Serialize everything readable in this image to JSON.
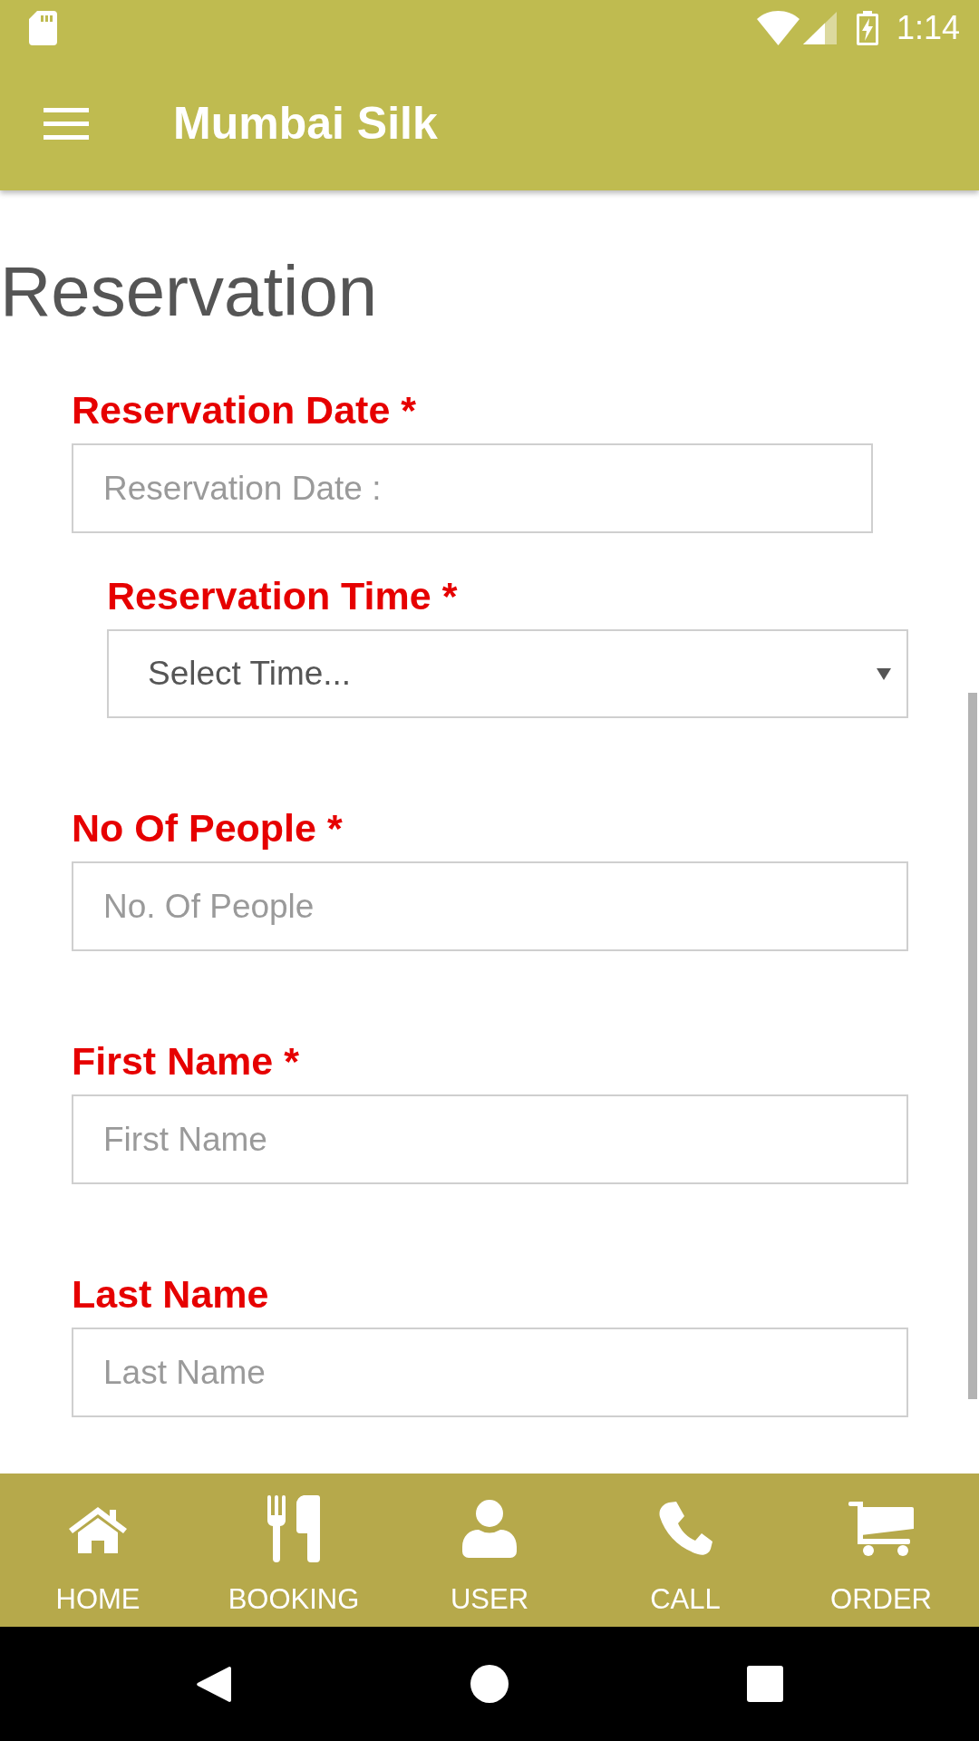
{
  "status_bar": {
    "time": "1:14"
  },
  "app_bar": {
    "title": "Mumbai Silk"
  },
  "page": {
    "heading": "Reservation"
  },
  "form": {
    "fields": [
      {
        "kind": "date",
        "label": "Reservation Date *",
        "placeholder": "Reservation Date :"
      },
      {
        "kind": "select",
        "label": "Reservation Time *",
        "value": "Select Time..."
      },
      {
        "kind": "text",
        "label": "No Of People *",
        "placeholder": "No. Of People"
      },
      {
        "kind": "text",
        "label": "First Name *",
        "placeholder": "First Name"
      },
      {
        "kind": "text",
        "label": "Last Name",
        "placeholder": "Last Name"
      }
    ]
  },
  "bottom_nav": {
    "items": [
      {
        "label": "HOME"
      },
      {
        "label": "BOOKING"
      },
      {
        "label": "USER"
      },
      {
        "label": "CALL"
      },
      {
        "label": "ORDER"
      }
    ]
  }
}
